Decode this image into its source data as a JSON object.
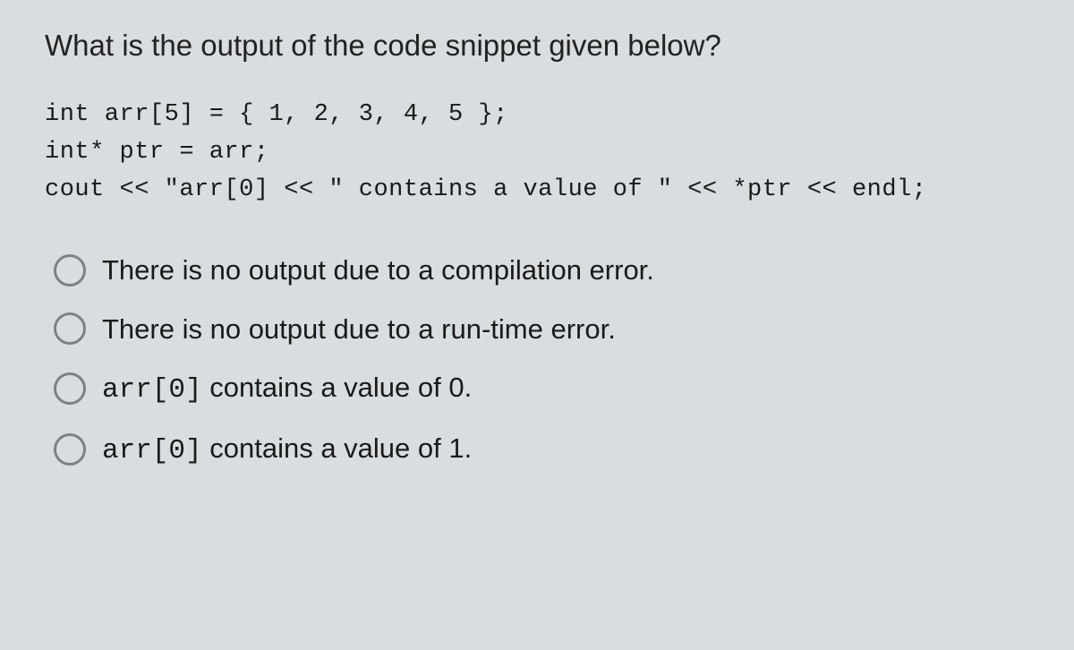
{
  "question": "What is the output of the code snippet given below?",
  "code": {
    "line1": "int arr[5] = { 1, 2, 3, 4, 5 };",
    "line2": "int* ptr = arr;",
    "line3": "cout << \"arr[0] << \" contains a value of \" << *ptr << endl;"
  },
  "options": {
    "a": "There is no output due to a compilation error.",
    "b": "There is no output due to a run-time error.",
    "c_pre": "arr[0]",
    "c_post": " contains a value of 0.",
    "d_pre": "arr[0]",
    "d_post": " contains a value of 1."
  }
}
